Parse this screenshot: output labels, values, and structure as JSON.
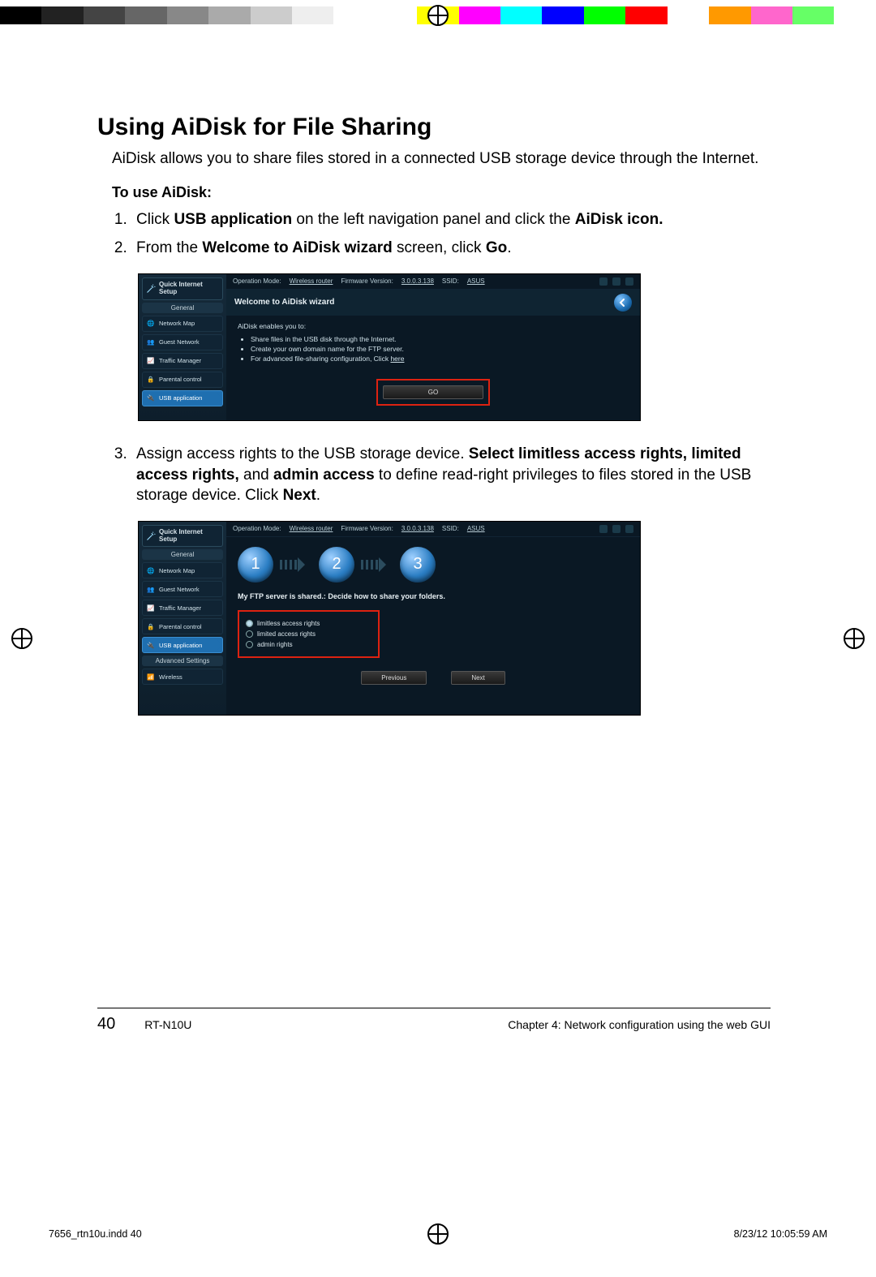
{
  "colorbar": [
    "#000000",
    "#222222",
    "#444444",
    "#666666",
    "#888888",
    "#aaaaaa",
    "#cccccc",
    "#eeeeee",
    "#ffffff",
    "#ffffff",
    "#ffff00",
    "#ff00ff",
    "#00ffff",
    "#0000ff",
    "#00ff00",
    "#ff0000",
    "#ffffff",
    "#ff9900",
    "#ff66cc",
    "#66ff66",
    "#ffffff"
  ],
  "heading": "Using AiDisk for File Sharing",
  "intro": "AiDisk allows you to share files stored in a connected USB storage device through the Internet.",
  "to_use": "To use AiDisk:",
  "steps": {
    "s1_a": "Click ",
    "s1_b": "USB application",
    "s1_c": " on the left navigation panel and click the ",
    "s1_d": "AiDisk icon.",
    "s2_a": "From the ",
    "s2_b": "Welcome to AiDisk wizard",
    "s2_c": " screen, click ",
    "s2_d": "Go",
    "s2_e": ".",
    "s3_a": "Assign access rights to the USB storage device. ",
    "s3_b": "Select limitless access rights, limited access rights,",
    "s3_c": " and ",
    "s3_d": "admin access",
    "s3_e": " to define read-right privileges to files stored in the USB storage device. Click ",
    "s3_f": "Next",
    "s3_g": "."
  },
  "shot_common": {
    "qis": "Quick Internet Setup",
    "general": "General",
    "nav": [
      "Network Map",
      "Guest Network",
      "Traffic Manager",
      "Parental control",
      "USB application"
    ],
    "advanced": "Advanced Settings",
    "wireless": "Wireless",
    "top_op": "Operation Mode:",
    "top_op_v": "Wireless router",
    "top_fw": "Firmware Version:",
    "top_fw_v": "3.0.0.3.138",
    "top_ssid": "SSID:",
    "top_ssid_v": "ASUS"
  },
  "shot1": {
    "title": "Welcome to AiDisk wizard",
    "enables": "AiDisk enables you to:",
    "bullets": [
      "Share files in the USB disk through the Internet.",
      "Create your own domain name for the FTP server.",
      "For advanced file-sharing configuration, Click "
    ],
    "here": "here",
    "go": "GO"
  },
  "shot2": {
    "circles": [
      "1",
      "2",
      "3"
    ],
    "ftp": "My FTP server is shared.: Decide how to share your folders.",
    "radios": [
      "limitless access rights",
      "limited access rights",
      "admin rights"
    ],
    "prev": "Previous",
    "next": "Next"
  },
  "footer": {
    "page": "40",
    "model": "RT-N10U",
    "chapter": "Chapter 4: Network configuration using the web GUI",
    "indd": "7656_rtn10u.indd   40",
    "datetime": "8/23/12   10:05:59 AM"
  }
}
